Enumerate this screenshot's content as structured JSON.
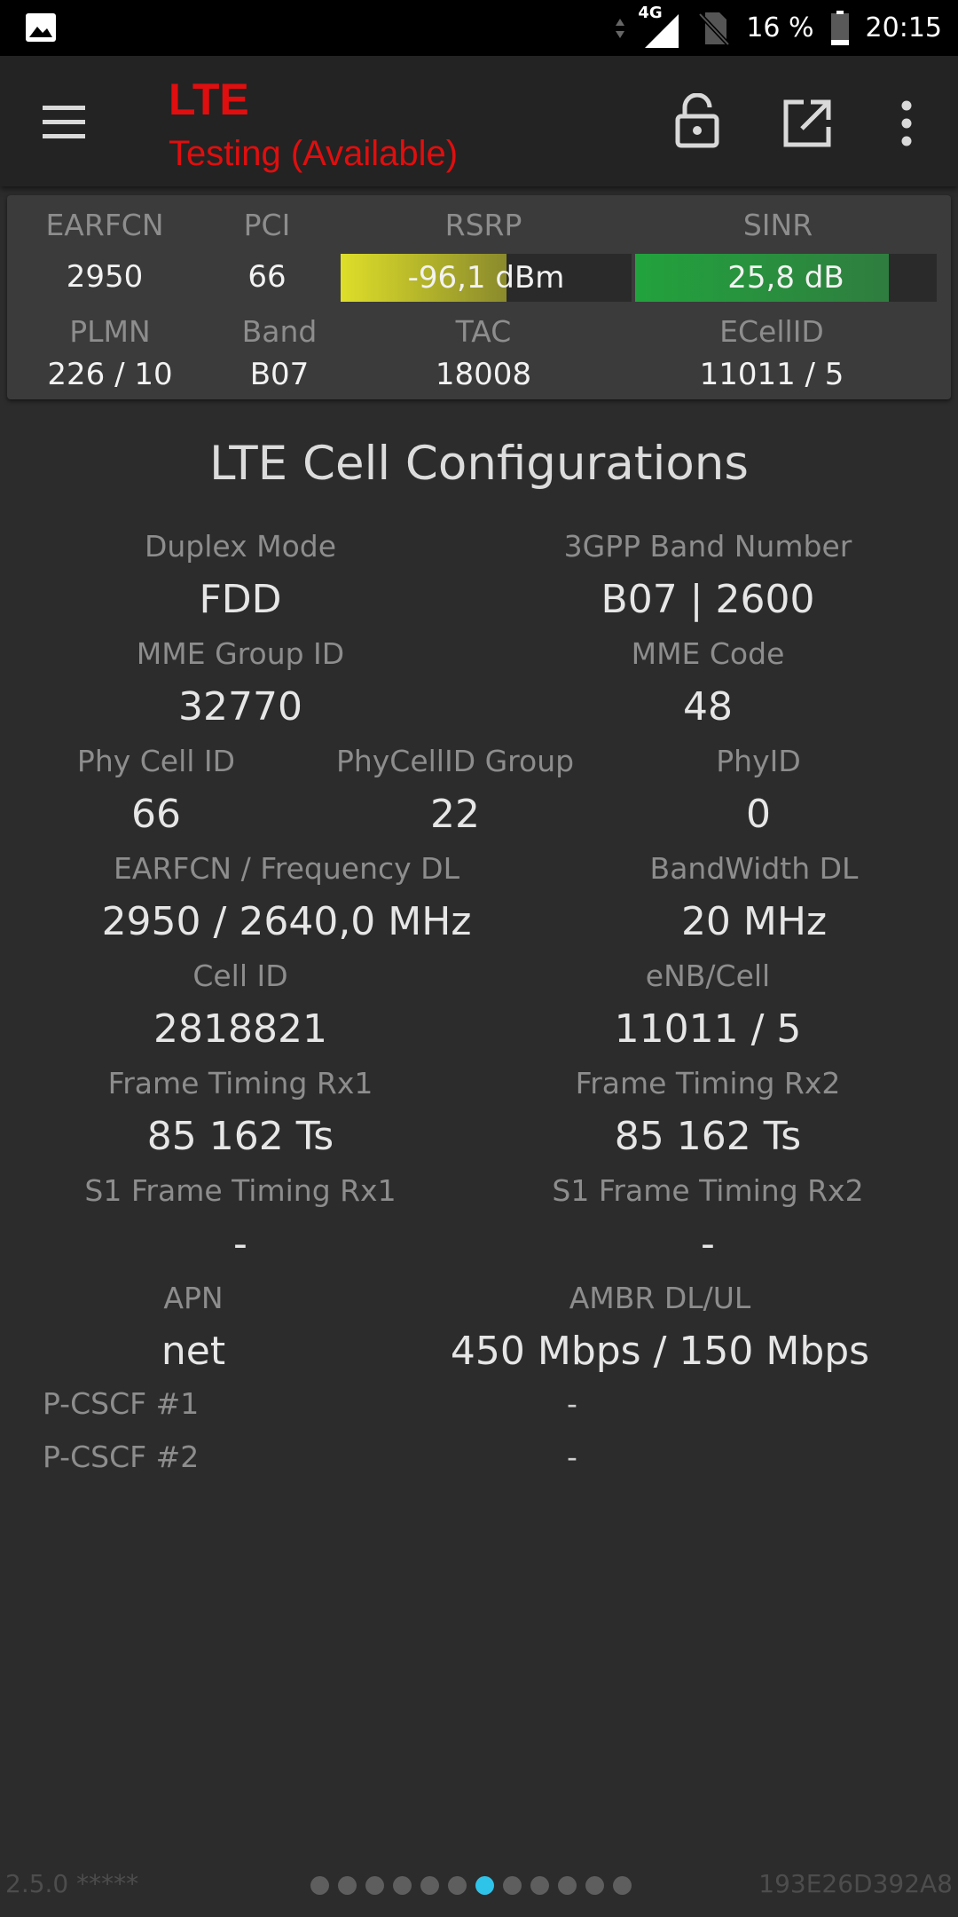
{
  "status_bar": {
    "network": "4G",
    "battery": "16 %",
    "time": "20:15"
  },
  "toolbar": {
    "title": "LTE",
    "subtitle": "Testing (Available)",
    "colors": {
      "title": "#e00e0e"
    },
    "icons": [
      "menu-icon",
      "lock-open-icon",
      "open-in-new-icon",
      "more-vert-icon"
    ]
  },
  "summary": {
    "earfcn_label": "EARFCN",
    "earfcn": "2950",
    "pci_label": "PCI",
    "pci": "66",
    "rsrp_label": "RSRP",
    "rsrp": "-96,1 dBm",
    "rsrp_level": 0.57,
    "sinr_label": "SINR",
    "sinr": "25,8 dB",
    "sinr_level": 0.84,
    "plmn_label": "PLMN",
    "plmn": "226 / 10",
    "band_label": "Band",
    "band": "B07",
    "tac_label": "TAC",
    "tac": "18008",
    "ecellid_label": "ECellID",
    "ecellid": "11011 / 5",
    "colors": {
      "rsrp_bar": "#dede2a",
      "sinr_bar": "#22a33d"
    }
  },
  "main": {
    "title": "LTE Cell Configurations",
    "fields": {
      "duplex_mode": {
        "label": "Duplex Mode",
        "value": "FDD"
      },
      "band_number": {
        "label": "3GPP Band Number",
        "value": "B07 | 2600"
      },
      "mme_group_id": {
        "label": "MME Group ID",
        "value": "32770"
      },
      "mme_code": {
        "label": "MME Code",
        "value": "48"
      },
      "phy_cell_id": {
        "label": "Phy Cell ID",
        "value": "66"
      },
      "phy_cell_id_group": {
        "label": "PhyCellID Group",
        "value": "22"
      },
      "phy_id": {
        "label": "PhyID",
        "value": "0"
      },
      "earfcn_freq_dl": {
        "label": "EARFCN / Frequency DL",
        "value": "2950 / 2640,0 MHz"
      },
      "bandwidth_dl": {
        "label": "BandWidth DL",
        "value": "20 MHz"
      },
      "cell_id": {
        "label": "Cell ID",
        "value": "2818821"
      },
      "enb_cell": {
        "label": "eNB/Cell",
        "value": "11011 / 5"
      },
      "frame_timing_rx1": {
        "label": "Frame Timing Rx1",
        "value": "85 162 Ts"
      },
      "frame_timing_rx2": {
        "label": "Frame Timing Rx2",
        "value": "85 162 Ts"
      },
      "s1_frame_timing_rx1": {
        "label": "S1 Frame Timing Rx1",
        "value": "-"
      },
      "s1_frame_timing_rx2": {
        "label": "S1 Frame Timing Rx2",
        "value": "-"
      },
      "apn": {
        "label": "APN",
        "value": "net"
      },
      "ambr": {
        "label": "AMBR DL/UL",
        "value": "450 Mbps / 150 Mbps"
      },
      "pcscf1": {
        "label": "P-CSCF #1",
        "value": "-"
      },
      "pcscf2": {
        "label": "P-CSCF #2",
        "value": "-"
      }
    }
  },
  "footer": {
    "version": "2.5.0 *****",
    "device_id": "193E26D392A8",
    "page_count": 12,
    "active_page": 7,
    "colors": {
      "active_dot": "#2ec4ea"
    }
  }
}
